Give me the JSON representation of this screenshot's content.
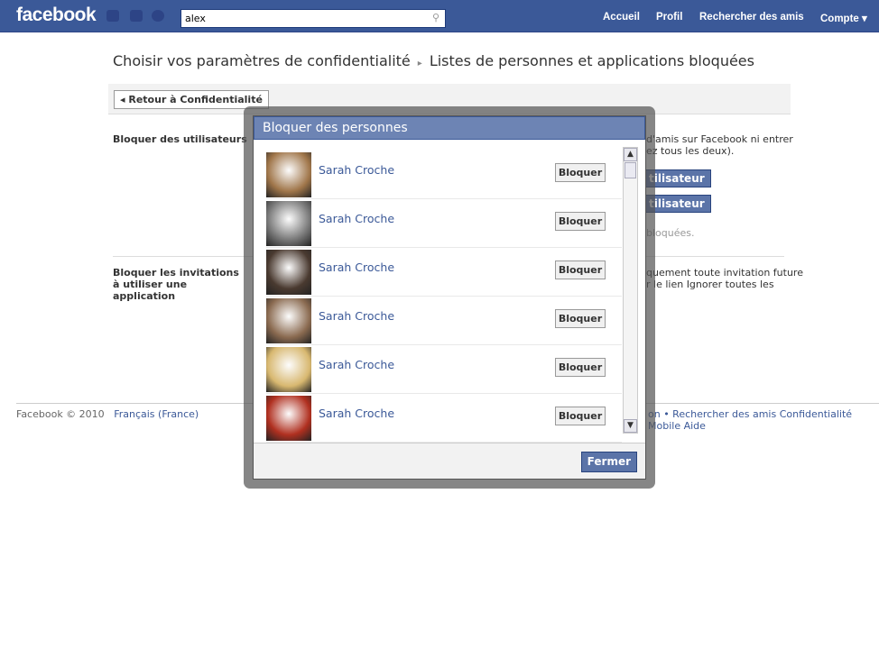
{
  "header": {
    "logo": "facebook",
    "search_value": "alex",
    "nav": [
      "Accueil",
      "Profil",
      "Rechercher des amis",
      "Compte ▾"
    ]
  },
  "breadcrumb": {
    "parent": "Choisir vos paramètres de confidentialité",
    "separator": "▸",
    "current": "Listes de personnes et applications bloquées"
  },
  "back_button": "◂ Retour à Confidentialité",
  "sections": {
    "block_users": {
      "title": "Bloquer des utilisateurs",
      "text1": "d'amis sur Facebook ni entrer",
      "text2": "ez tous les deux).",
      "button1": "tilisateur",
      "button2": "tilisateur",
      "note": "bloquées."
    },
    "block_invites": {
      "title": "Bloquer les invitations à utiliser une application",
      "text1": "quement toute invitation future",
      "text2": "r le lien Ignorer toutes les"
    }
  },
  "footer": {
    "copyright": "Facebook © 2010",
    "language": "Français (France)",
    "links": "on  •  Rechercher des amis  Confidentialité  Mobile  Aide"
  },
  "dialog": {
    "title": "Bloquer des personnes",
    "close_label": "Fermer",
    "people": [
      {
        "name": "Sarah Croche",
        "action": "Bloquer",
        "color": "#a0764a"
      },
      {
        "name": "Sarah Croche",
        "action": "Bloquer",
        "color": "#777777"
      },
      {
        "name": "Sarah Croche",
        "action": "Bloquer",
        "color": "#4a3a30"
      },
      {
        "name": "Sarah Croche",
        "action": "Bloquer",
        "color": "#8a6a50"
      },
      {
        "name": "Sarah Croche",
        "action": "Bloquer",
        "color": "#d8b870"
      },
      {
        "name": "Sarah Croche",
        "action": "Bloquer",
        "color": "#b03020"
      }
    ]
  },
  "colors": {
    "brand": "#3b5998",
    "dialog_title": "#6d84b4"
  }
}
